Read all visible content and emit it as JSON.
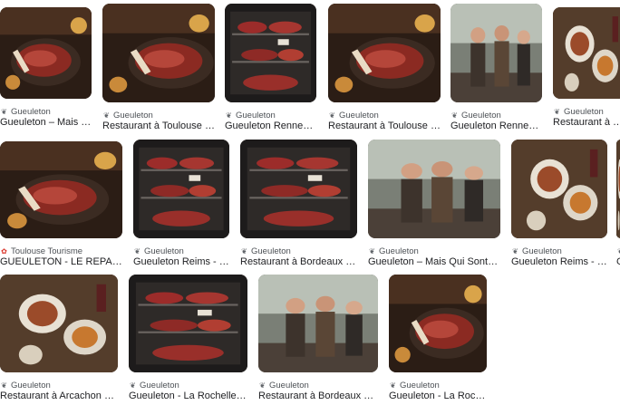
{
  "results": [
    {
      "source": "Gueuleton",
      "title": "Gueuleton – Mais Qui …",
      "scene": "steak",
      "icon": "site-icon"
    },
    {
      "source": "Gueuleton",
      "title": "Restaurant à Toulouse – Gu…",
      "scene": "steak",
      "icon": "site-icon"
    },
    {
      "source": "Gueuleton",
      "title": "Gueuleton Rennes - G…",
      "scene": "fridge",
      "icon": "site-icon"
    },
    {
      "source": "Gueuleton",
      "title": "Restaurant à Toulouse – Gu…",
      "scene": "steak",
      "icon": "site-icon"
    },
    {
      "source": "Gueuleton",
      "title": "Gueuleton Rennes - G…",
      "scene": "people",
      "icon": "site-icon"
    },
    {
      "source": "Gueuleton",
      "title": "Restaurant à Borde…",
      "scene": "plates",
      "icon": "site-icon"
    },
    {
      "source": "Toulouse Tourisme",
      "title": "GUEULETON - LE REPAIRE D…",
      "scene": "steak",
      "icon": "tourism-icon"
    },
    {
      "source": "Gueuleton",
      "title": "Gueuleton Reims - Le …",
      "scene": "fridge",
      "icon": "site-icon"
    },
    {
      "source": "Gueuleton",
      "title": "Restaurant à Bordeaux – Gue…",
      "scene": "fridge",
      "icon": "site-icon"
    },
    {
      "source": "Gueuleton",
      "title": "Gueuleton – Mais Qui Sont ces B…",
      "scene": "people",
      "icon": "site-icon"
    },
    {
      "source": "Gueuleton",
      "title": "Gueuleton Reims - Le …",
      "scene": "plates",
      "icon": "site-icon"
    },
    {
      "source": "Gueuleton",
      "title": "Gueuleton Paris - Gueuleton",
      "scene": "people",
      "icon": "site-icon"
    },
    {
      "source": "Gueuleton",
      "title": "Restaurant à Arcachon – Gue…",
      "scene": "plates",
      "icon": "site-icon"
    },
    {
      "source": "Gueuleton",
      "title": "Gueuleton - La Rochelle - Gue…",
      "scene": "fridge",
      "icon": "site-icon"
    },
    {
      "source": "Gueuleton",
      "title": "Restaurant à Bordeaux …",
      "scene": "people",
      "icon": "site-icon"
    },
    {
      "source": "Gueuleton",
      "title": "Gueuleton - La Rochelle - Gue…",
      "scene": "steak",
      "icon": "site-icon"
    }
  ]
}
